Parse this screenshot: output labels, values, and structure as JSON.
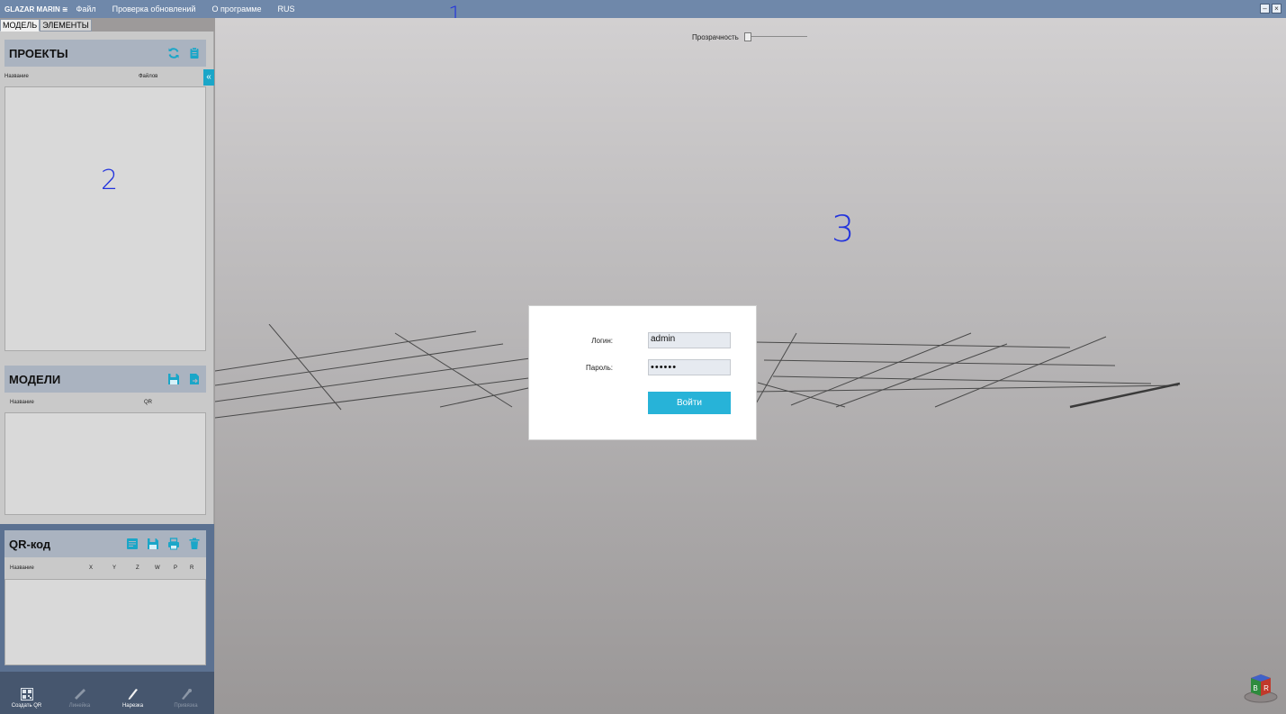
{
  "app": {
    "brand": "GLAZAR MARIN",
    "brand_symbol": "≅"
  },
  "menu": {
    "file": "Файл",
    "updates": "Проверка обновлений",
    "about": "О программе",
    "lang": "RUS"
  },
  "window": {
    "minimize": "–",
    "close": "×"
  },
  "tabs": {
    "model": "МОДЕЛЬ",
    "elements": "ЭЛЕМЕНТЫ"
  },
  "annotations": {
    "a1": "1",
    "a2": "2",
    "a3": "3"
  },
  "projects": {
    "title": "ПРОЕКТЫ",
    "col_name": "Название",
    "col_files": "Файлов",
    "collapse": "«"
  },
  "models": {
    "title": "МОДЕЛИ",
    "col_name": "Название",
    "col_qr": "QR"
  },
  "qr": {
    "title": "QR-код",
    "col_name": "Название",
    "cols": [
      "X",
      "Y",
      "Z",
      "W",
      "P",
      "R"
    ]
  },
  "toolbar": {
    "create_qr": "Создать QR",
    "ruler": "Линейка",
    "slicing": "Нарезка",
    "snap": "Привязка"
  },
  "viewport": {
    "opacity_label": "Прозрачность",
    "opacity_value": 0
  },
  "login": {
    "login_label": "Логин:",
    "login_value": "admin",
    "password_label": "Пароль:",
    "password_value": "••••••",
    "submit": "Войти"
  },
  "colors": {
    "accent": "#27b3d8",
    "menubar": "#6f88aa",
    "icon": "#1aa6c8"
  },
  "cube_faces": {
    "left": "B",
    "right": "R"
  }
}
